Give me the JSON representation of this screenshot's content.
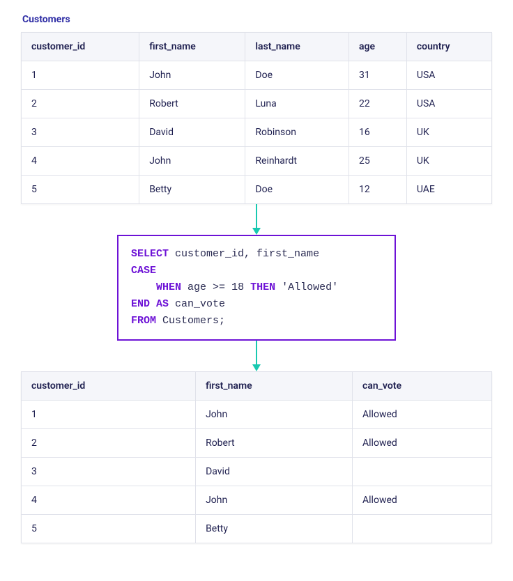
{
  "source": {
    "title": "Customers",
    "columns": [
      "customer_id",
      "first_name",
      "last_name",
      "age",
      "country"
    ],
    "rows": [
      [
        "1",
        "John",
        "Doe",
        "31",
        "USA"
      ],
      [
        "2",
        "Robert",
        "Luna",
        "22",
        "USA"
      ],
      [
        "3",
        "David",
        "Robinson",
        "16",
        "UK"
      ],
      [
        "4",
        "John",
        "Reinhardt",
        "25",
        "UK"
      ],
      [
        "5",
        "Betty",
        "Doe",
        "12",
        "UAE"
      ]
    ]
  },
  "sql": {
    "tokens1": [
      [
        "kw",
        "SELECT"
      ],
      [
        "sp",
        " "
      ],
      [
        "ident",
        "customer_id, first_name"
      ]
    ],
    "tokens2": [
      [
        "kw",
        "CASE"
      ]
    ],
    "tokens3": [
      [
        "sp",
        "    "
      ],
      [
        "kw",
        "WHEN"
      ],
      [
        "sp",
        " "
      ],
      [
        "ident",
        "age >= "
      ],
      [
        "num",
        "18"
      ],
      [
        "sp",
        " "
      ],
      [
        "kw",
        "THEN"
      ],
      [
        "sp",
        " "
      ],
      [
        "str",
        "'Allowed'"
      ]
    ],
    "tokens4": [
      [
        "kw",
        "END AS"
      ],
      [
        "sp",
        " "
      ],
      [
        "ident",
        "can_vote"
      ]
    ],
    "tokens5": [
      [
        "kw",
        "FROM"
      ],
      [
        "sp",
        " "
      ],
      [
        "ident",
        "Customers;"
      ]
    ]
  },
  "result": {
    "columns": [
      "customer_id",
      "first_name",
      "can_vote"
    ],
    "rows": [
      [
        "1",
        "John",
        "Allowed"
      ],
      [
        "2",
        "Robert",
        "Allowed"
      ],
      [
        "3",
        "David",
        ""
      ],
      [
        "4",
        "John",
        "Allowed"
      ],
      [
        "5",
        "Betty",
        ""
      ]
    ]
  }
}
